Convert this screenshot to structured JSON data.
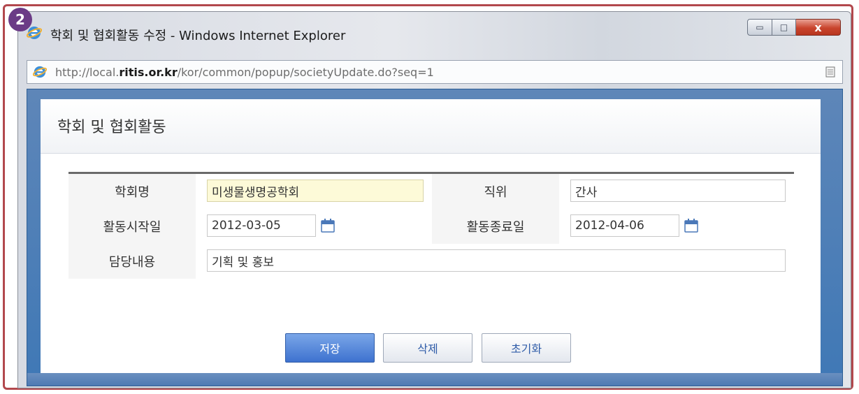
{
  "step_badge": "2",
  "window": {
    "title": "학회 및 협회활동 수정 - Windows Internet Explorer",
    "caption_buttons": {
      "minimize": "▭",
      "maximize": "□",
      "close": "x"
    }
  },
  "address_bar": {
    "prefix": "http://local.",
    "domain": "ritis.or.kr",
    "path": "/kor/common/popup/societyUpdate.do?seq=1"
  },
  "dialog": {
    "title": "학회 및 협회활동",
    "form": {
      "society_name": {
        "label": "학회명",
        "value": "미생물생명공학회"
      },
      "position": {
        "label": "직위",
        "value": "간사"
      },
      "start_date": {
        "label": "활동시작일",
        "value": "2012-03-05"
      },
      "end_date": {
        "label": "활동종료일",
        "value": "2012-04-06"
      },
      "description": {
        "label": "담당내용",
        "value": "기획 및 홍보"
      }
    },
    "buttons": {
      "save": "저장",
      "delete": "삭제",
      "reset": "초기화"
    }
  },
  "colors": {
    "frame_border": "#b2484d",
    "badge": "#6b3b86",
    "content_frame": "#3f78b6",
    "primary_button": "#3e72cf",
    "highlight_field": "#fdfad8"
  },
  "icons": [
    "ie-icon",
    "page-icon",
    "calendar-icon"
  ]
}
